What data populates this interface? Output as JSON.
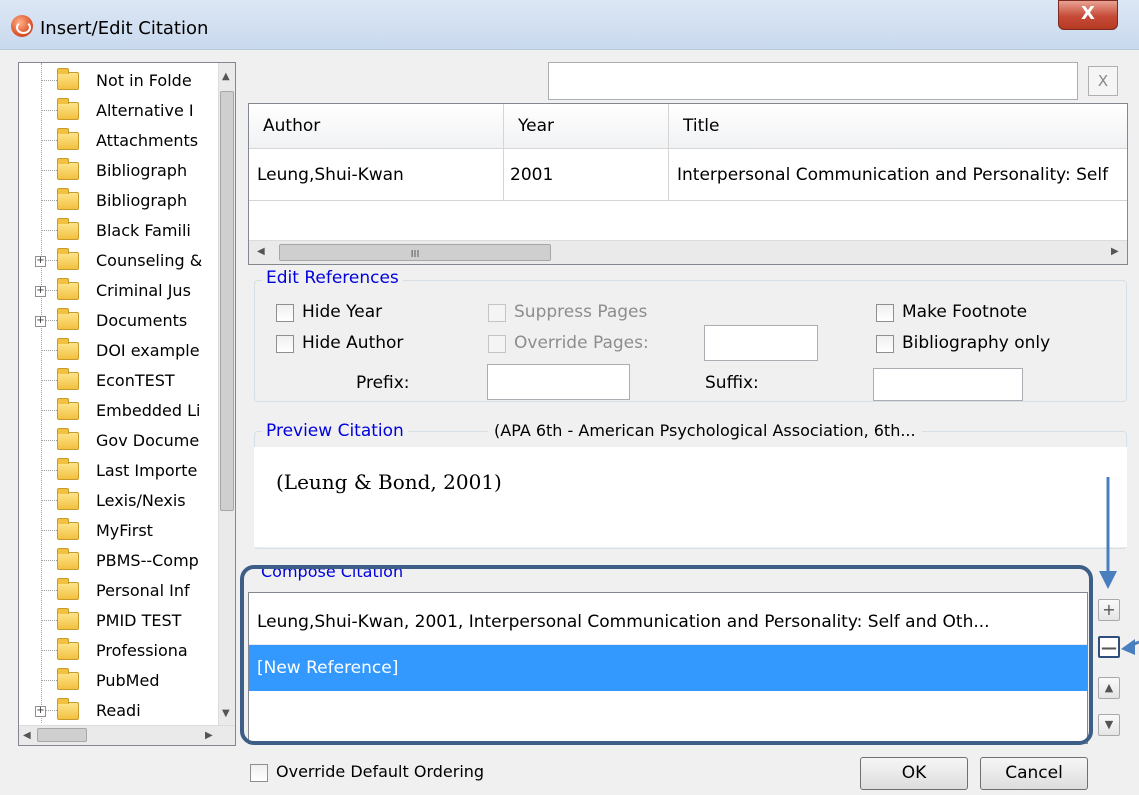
{
  "window": {
    "title": "Insert/Edit Citation",
    "close_glyph": "X"
  },
  "folders": [
    {
      "label": "Not in Folde",
      "expandable": false
    },
    {
      "label": "Alternative I",
      "expandable": false
    },
    {
      "label": "Attachments",
      "expandable": false
    },
    {
      "label": "Bibliograph",
      "expandable": false
    },
    {
      "label": "Bibliograph",
      "expandable": false
    },
    {
      "label": "Black Famili",
      "expandable": false
    },
    {
      "label": "Counseling &",
      "expandable": true
    },
    {
      "label": "Criminal Jus",
      "expandable": true
    },
    {
      "label": "Documents",
      "expandable": true
    },
    {
      "label": "DOI example",
      "expandable": false
    },
    {
      "label": "EconTEST",
      "expandable": false
    },
    {
      "label": "Embedded Li",
      "expandable": false
    },
    {
      "label": "Gov Docume",
      "expandable": false
    },
    {
      "label": "Last Importe",
      "expandable": false
    },
    {
      "label": "Lexis/Nexis",
      "expandable": false
    },
    {
      "label": "MyFirst",
      "expandable": false
    },
    {
      "label": "PBMS--Comp",
      "expandable": false
    },
    {
      "label": "Personal Inf",
      "expandable": false
    },
    {
      "label": "PMID TEST",
      "expandable": false
    },
    {
      "label": "Professiona",
      "expandable": false
    },
    {
      "label": "PubMed",
      "expandable": false
    },
    {
      "label": "Readi",
      "expandable": true
    }
  ],
  "search": {
    "value": "",
    "clear_label": "X"
  },
  "grid": {
    "headers": {
      "author": "Author",
      "year": "Year",
      "title": "Title"
    },
    "row": {
      "author": "Leung,Shui-Kwan",
      "year": "2001",
      "title": "Interpersonal Communication and Personality: Self"
    },
    "scroll_grip": "III"
  },
  "edit_refs": {
    "title": "Edit References",
    "hide_year": "Hide Year",
    "hide_author": "Hide Author",
    "suppress_pages": "Suppress Pages",
    "override_pages": "Override Pages:",
    "make_footnote": "Make Footnote",
    "bibliography_only": "Bibliography only",
    "prefix": "Prefix:",
    "suffix": "Suffix:"
  },
  "preview": {
    "title": "Preview Citation",
    "style": "(APA 6th - American Psychological Association, 6th...",
    "text": "(Leung & Bond, 2001)"
  },
  "compose": {
    "title": "Compose Citation",
    "items": [
      "Leung,Shui-Kwan, 2001, Interpersonal Communication and Personality: Self and Oth...",
      "[New Reference]"
    ],
    "selected_index": 1
  },
  "footer": {
    "override_ordering": "Override Default Ordering",
    "ok": "OK",
    "cancel": "Cancel"
  },
  "colors": {
    "accent": "#3399ff",
    "annotation": "#3c5e87",
    "group_title": "#0000dd"
  },
  "icons": [
    "app-icon",
    "folder-icon",
    "plus-icon",
    "minus-icon",
    "arrow-up-icon",
    "arrow-down-icon",
    "close-icon"
  ]
}
